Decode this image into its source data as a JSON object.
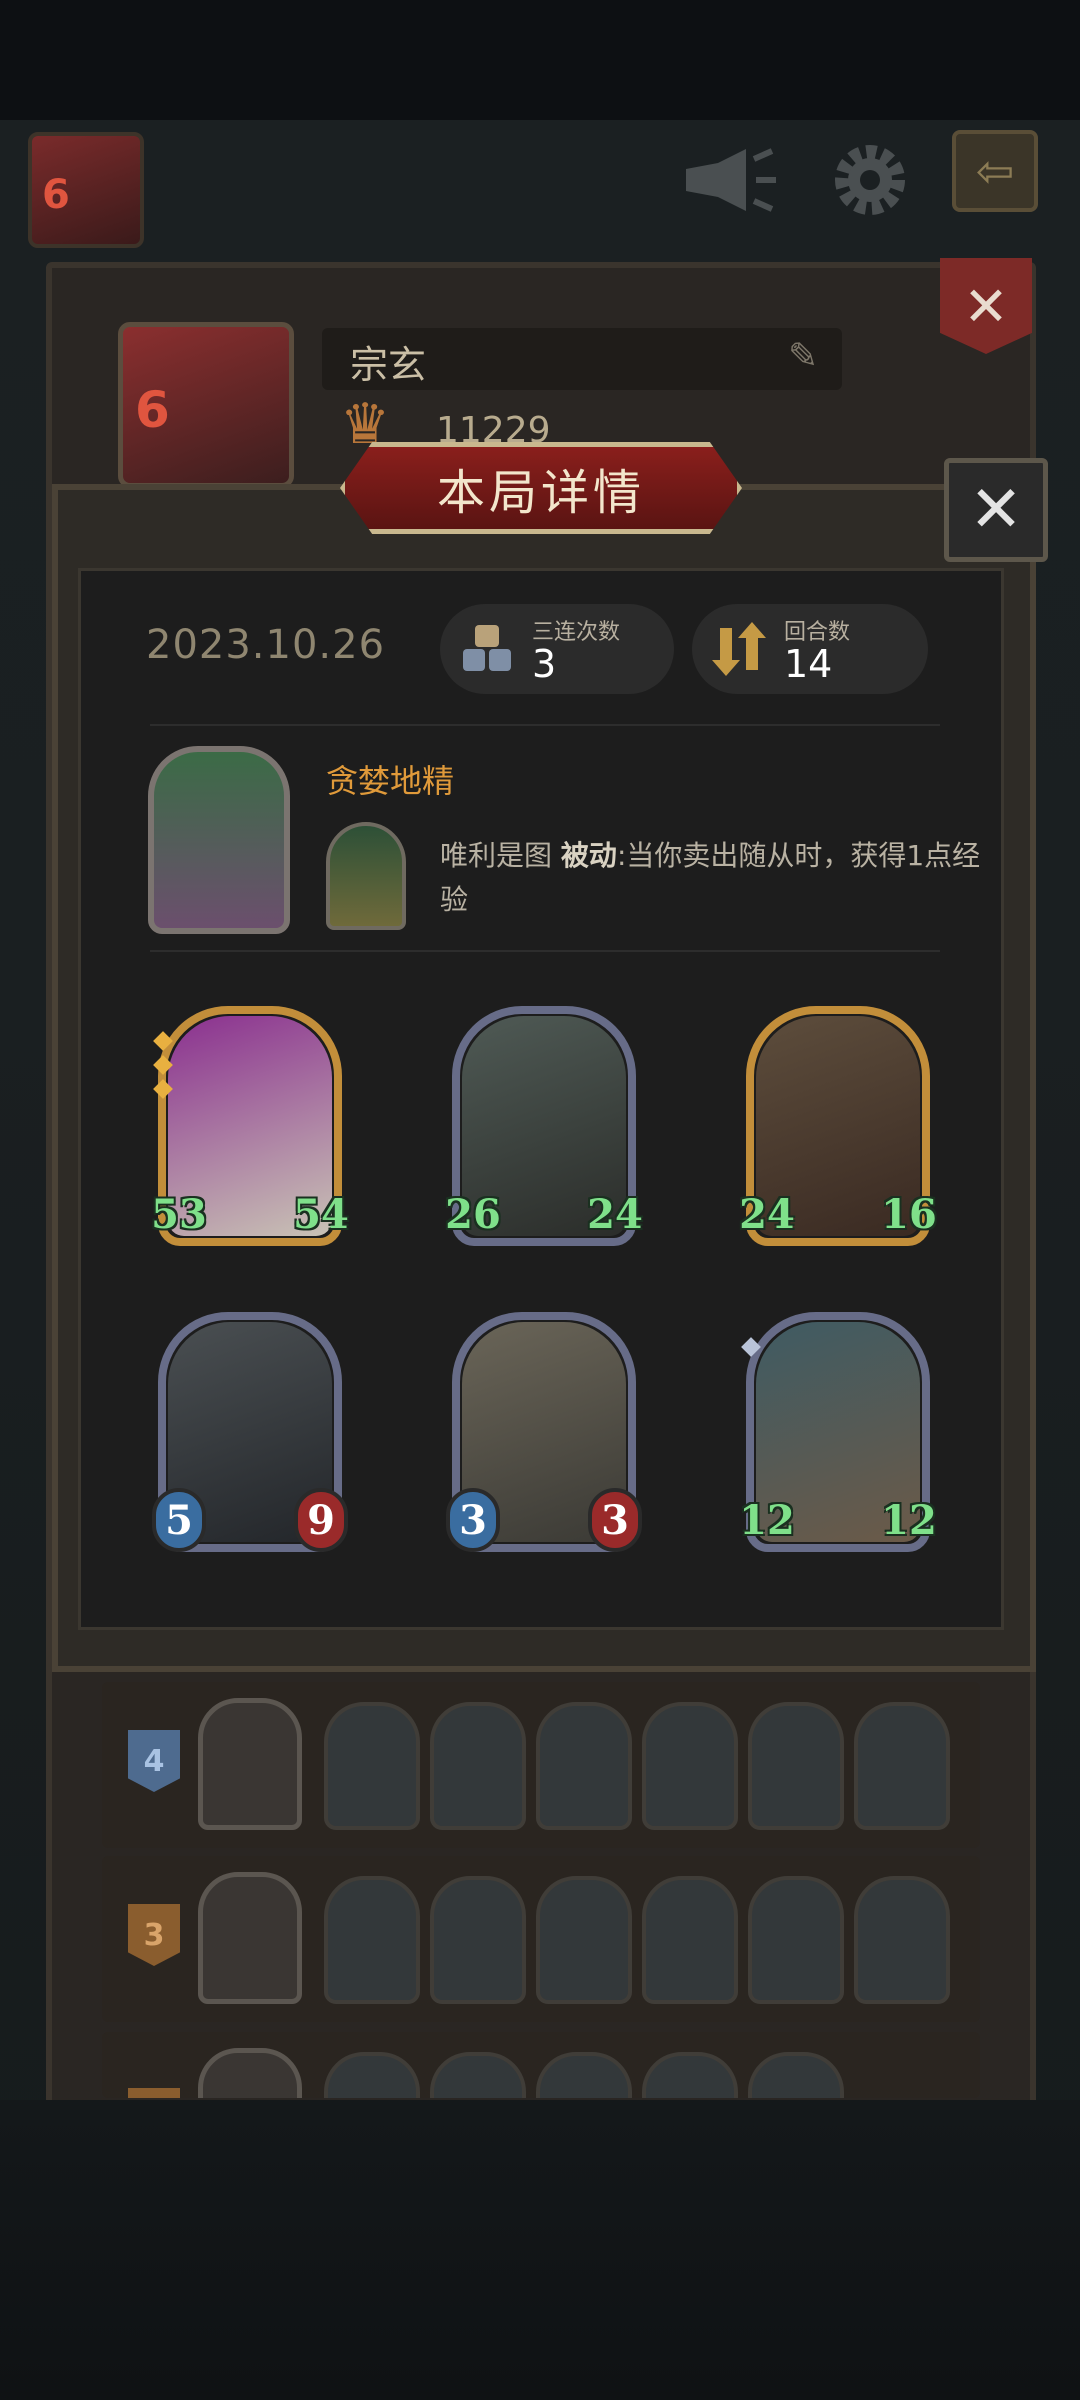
{
  "top_bar": {
    "avatar_level": "6",
    "icons": [
      "megaphone-icon",
      "gear-icon",
      "back-arrow-icon"
    ]
  },
  "profile": {
    "name": "宗玄",
    "score": "11229",
    "avatar_level": "6"
  },
  "modal": {
    "title": "本局详情",
    "date": "2023.10.26",
    "triple_label": "三连次数",
    "triple_value": "3",
    "rounds_label": "回合数",
    "rounds_value": "14",
    "hero": {
      "name": "贪婪地精",
      "skill_name": "唯利是图",
      "skill_type": "被动",
      "skill_text": ":当你卖出随从时，获得1点经验"
    },
    "units": [
      {
        "atk": "53",
        "hp": "54",
        "frame": "gold",
        "stat_style": "green",
        "stars": 3
      },
      {
        "atk": "26",
        "hp": "24",
        "frame": "silver",
        "stat_style": "green",
        "stars": 0
      },
      {
        "atk": "24",
        "hp": "16",
        "frame": "gold",
        "stat_style": "green",
        "stars": 0
      },
      {
        "atk": "5",
        "hp": "9",
        "frame": "silver",
        "stat_style": "plain",
        "stars": 0
      },
      {
        "atk": "3",
        "hp": "3",
        "frame": "silver",
        "stat_style": "plain",
        "stars": 0
      },
      {
        "atk": "12",
        "hp": "12",
        "frame": "silver",
        "stat_style": "green",
        "stars": 1
      }
    ]
  },
  "history": [
    {
      "rank": "4"
    },
    {
      "rank": "3"
    },
    {
      "rank": ""
    }
  ],
  "colors": {
    "accent_gold": "#c28e3a",
    "hero_name": "#e09a3a",
    "banner_red": "#8a1f1c"
  }
}
